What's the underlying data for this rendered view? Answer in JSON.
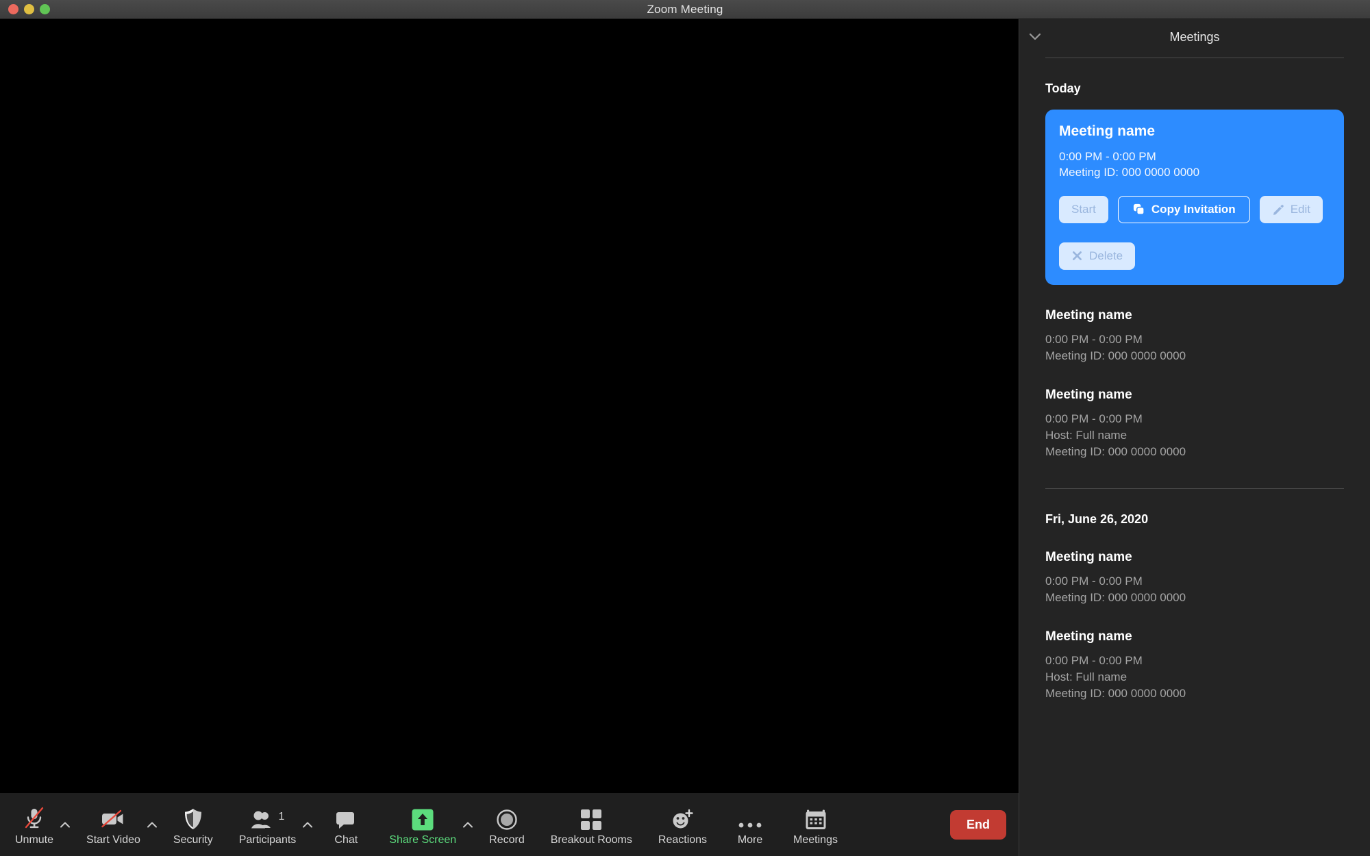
{
  "window": {
    "title": "Zoom Meeting",
    "traffic_lights": [
      "close-red",
      "minimize-yellow",
      "maximize-green"
    ],
    "colors": {
      "accent_blue": "#2d8cff",
      "end_red": "#c23b32",
      "share_green": "#5cdc7d",
      "sidebar_bg": "#242424",
      "toolbar_bg": "#1f1f1f",
      "stage_bg": "#000000"
    }
  },
  "sidebar": {
    "title": "Meetings",
    "collapse_icon": "chevron-down-icon",
    "groups": [
      {
        "day_label": "Today",
        "meetings": [
          {
            "selected": true,
            "name": "Meeting name",
            "time": "0:00 PM - 0:00 PM",
            "meeting_id": "Meeting ID: 000 0000 0000",
            "host": null,
            "actions": [
              {
                "label": "Start",
                "icon": null,
                "style": "ghost"
              },
              {
                "label": "Copy Invitation",
                "icon": "copy-icon",
                "style": "outline"
              },
              {
                "label": "Edit",
                "icon": "pencil-icon",
                "style": "ghost"
              },
              {
                "label": "Delete",
                "icon": "close-icon",
                "style": "ghost"
              }
            ]
          },
          {
            "selected": false,
            "name": "Meeting name",
            "time": "0:00 PM - 0:00 PM",
            "meeting_id": "Meeting ID: 000 0000 0000",
            "host": null
          },
          {
            "selected": false,
            "name": "Meeting name",
            "time": "0:00 PM - 0:00 PM",
            "meeting_id": "Meeting ID: 000 0000 0000",
            "host": "Host: Full name"
          }
        ]
      },
      {
        "day_label": "Fri, June 26, 2020",
        "meetings": [
          {
            "selected": false,
            "name": "Meeting name",
            "time": "0:00 PM - 0:00 PM",
            "meeting_id": "Meeting ID: 000 0000 0000",
            "host": null
          },
          {
            "selected": false,
            "name": "Meeting name",
            "time": "0:00 PM - 0:00 PM",
            "meeting_id": "Meeting ID: 000 0000 0000",
            "host": "Host: Full name"
          }
        ]
      }
    ]
  },
  "toolbar": {
    "items": [
      {
        "label": "Unmute",
        "icon": "microphone-muted-icon",
        "caret": true,
        "state": "muted"
      },
      {
        "label": "Start Video",
        "icon": "video-muted-icon",
        "caret": true,
        "state": "muted"
      },
      {
        "label": "Security",
        "icon": "shield-icon",
        "caret": false
      },
      {
        "label": "Participants",
        "icon": "participants-icon",
        "caret": true,
        "badge": "1"
      },
      {
        "label": "Chat",
        "icon": "chat-bubble-icon",
        "caret": false
      },
      {
        "label": "Share Screen",
        "icon": "share-screen-icon",
        "caret": true,
        "state": "active"
      },
      {
        "label": "Record",
        "icon": "record-icon",
        "caret": false
      },
      {
        "label": "Breakout Rooms",
        "icon": "breakout-rooms-icon",
        "caret": false
      },
      {
        "label": "Reactions",
        "icon": "reactions-icon",
        "caret": false
      },
      {
        "label": "More",
        "icon": "ellipsis-icon",
        "caret": false
      },
      {
        "label": "Meetings",
        "icon": "calendar-icon",
        "caret": false
      }
    ],
    "end_label": "End"
  }
}
